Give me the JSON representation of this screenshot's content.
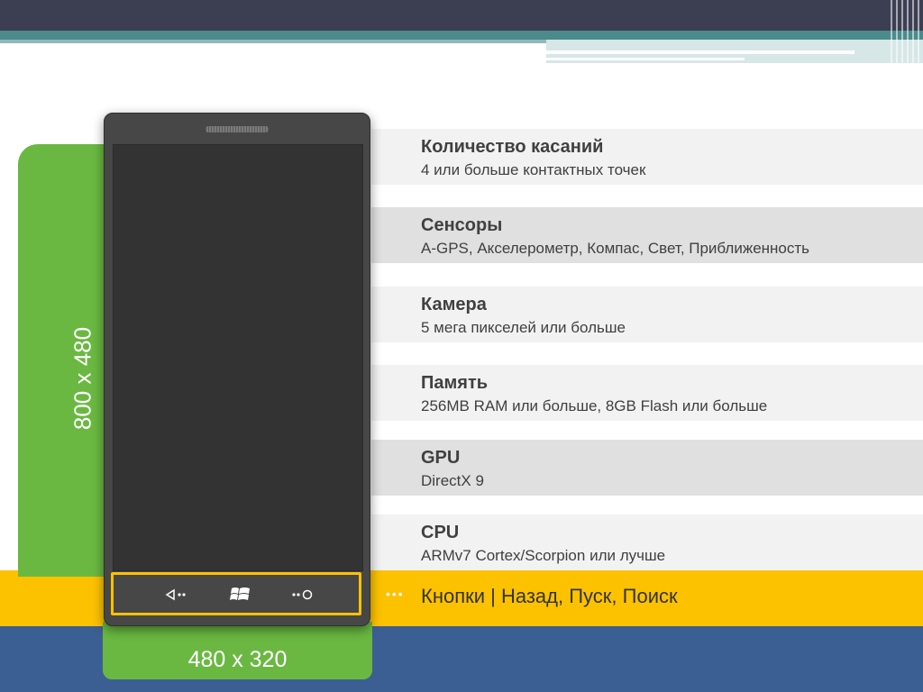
{
  "spec_rows": [
    {
      "title": "Количество касаний",
      "value": "4 или больше контактных точек"
    },
    {
      "title": "Сенсоры",
      "value": "A-GPS, Акселерометр, Компас, Свет, Приближенность"
    },
    {
      "title": "Камера",
      "value": "5 мега пикселей или больше"
    },
    {
      "title": "Память",
      "value": "256MB RAM или больше, 8GB Flash или больше"
    },
    {
      "title": "GPU",
      "value": "DirectX 9"
    },
    {
      "title": "CPU",
      "value": "ARMv7 Cortex/Scorpion или лучше"
    }
  ],
  "buttons_text": "Кнопки | Назад, Пуск, Поиск",
  "height_label": "800 x 480",
  "width_label": "480 x 320",
  "colors": {
    "green": "#6ab841",
    "yellow": "#fcc200",
    "blue": "#3c5f93",
    "header": "#3c3f52",
    "teal": "#4b8b8c"
  },
  "icons": {
    "back": "back-arrow-icon",
    "start": "windows-logo-icon",
    "search": "search-icon"
  }
}
